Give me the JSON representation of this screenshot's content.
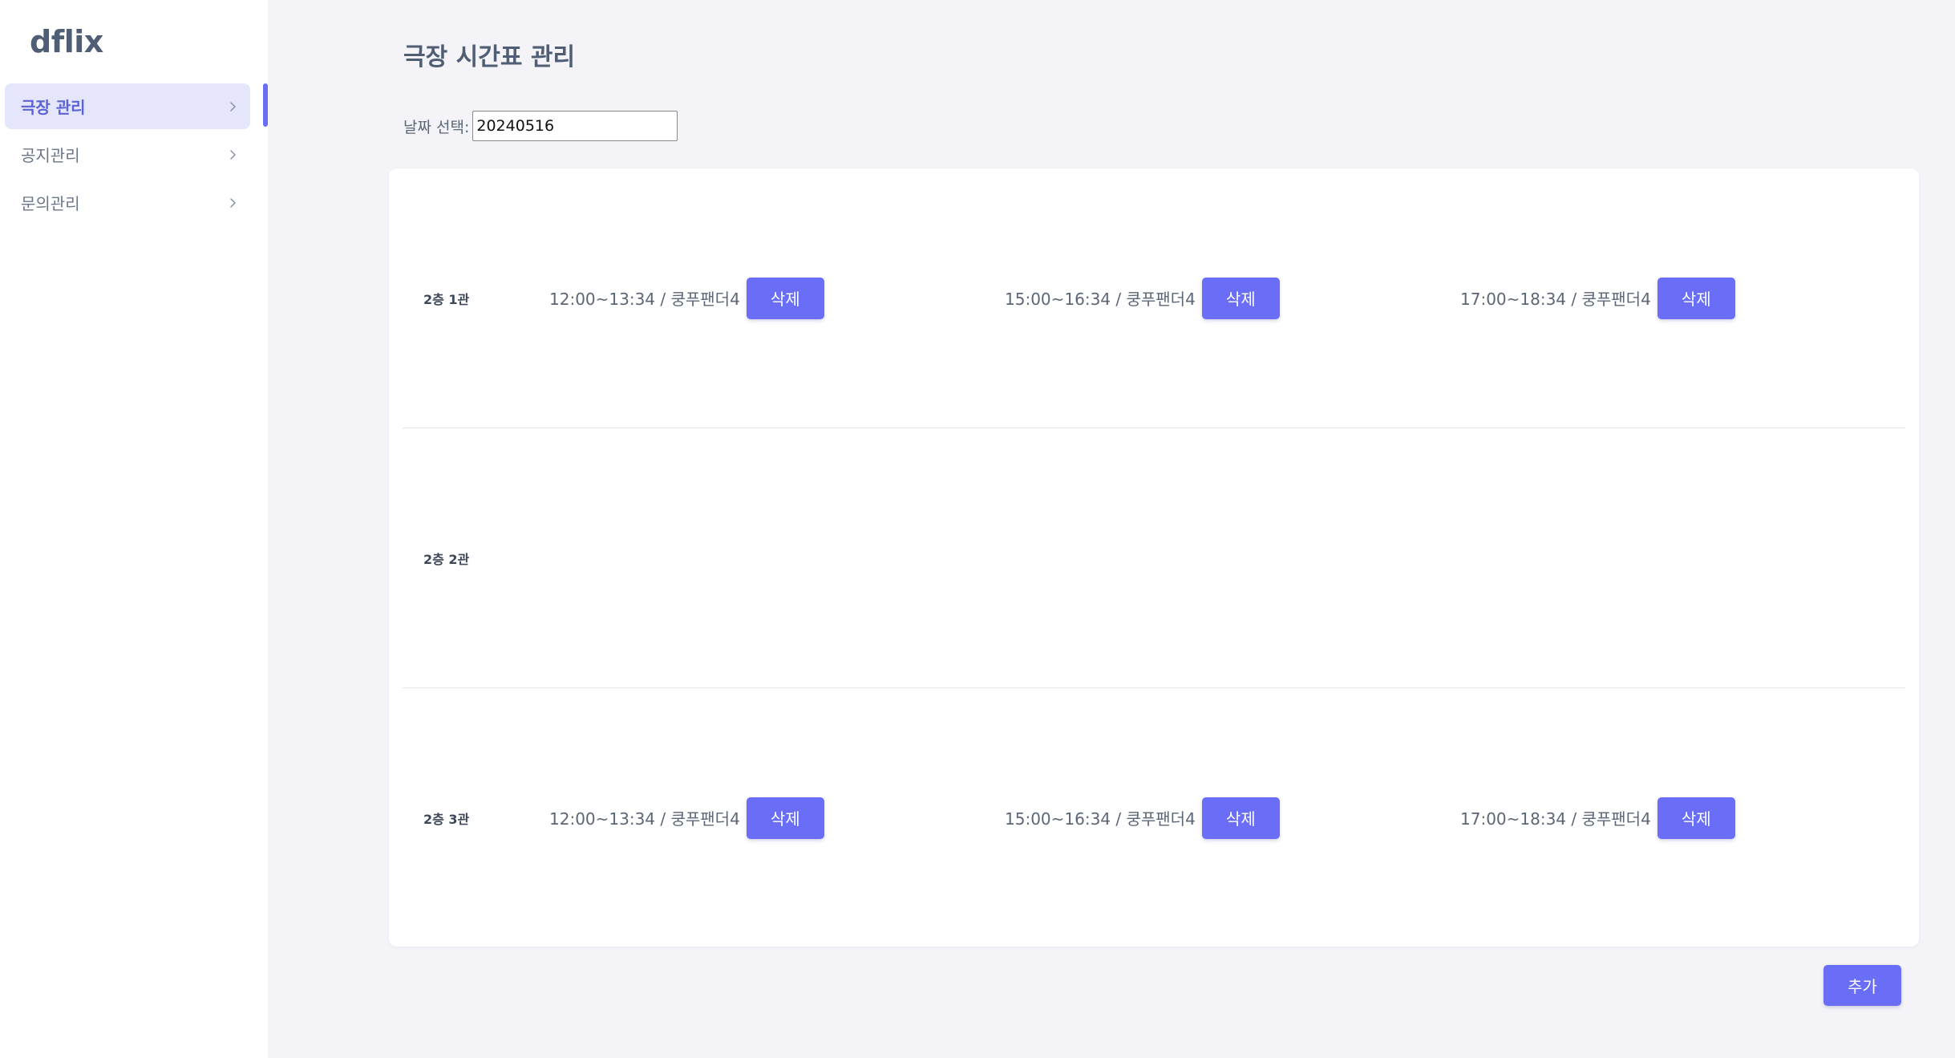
{
  "app": {
    "logo": "dflix"
  },
  "sidebar": {
    "items": [
      {
        "label": "극장 관리",
        "active": true
      },
      {
        "label": "공지관리",
        "active": false
      },
      {
        "label": "문의관리",
        "active": false
      }
    ],
    "chevron_icon": "chevron-right-icon"
  },
  "page": {
    "title": "극장 시간표 관리"
  },
  "date_picker": {
    "label": "날짜 선택:",
    "value": "20240516"
  },
  "halls": [
    {
      "name": "2층 1관",
      "slots": [
        {
          "text": "12:00~13:34 / 쿵푸팬더4",
          "button": "삭제"
        },
        {
          "text": "15:00~16:34 / 쿵푸팬더4",
          "button": "삭제"
        },
        {
          "text": "17:00~18:34 / 쿵푸팬더4",
          "button": "삭제"
        }
      ]
    },
    {
      "name": "2층 2관",
      "slots": []
    },
    {
      "name": "2층 3관",
      "slots": [
        {
          "text": "12:00~13:34 / 쿵푸팬더4",
          "button": "삭제"
        },
        {
          "text": "15:00~16:34 / 쿵푸팬더4",
          "button": "삭제"
        },
        {
          "text": "17:00~18:34 / 쿵푸팬더4",
          "button": "삭제"
        }
      ]
    }
  ],
  "actions": {
    "add_label": "추가"
  },
  "colors": {
    "accent": "#6a6ef6",
    "active_bg": "#e5e6fb",
    "page_bg": "#f4f4f8",
    "text": "#5b6677"
  }
}
